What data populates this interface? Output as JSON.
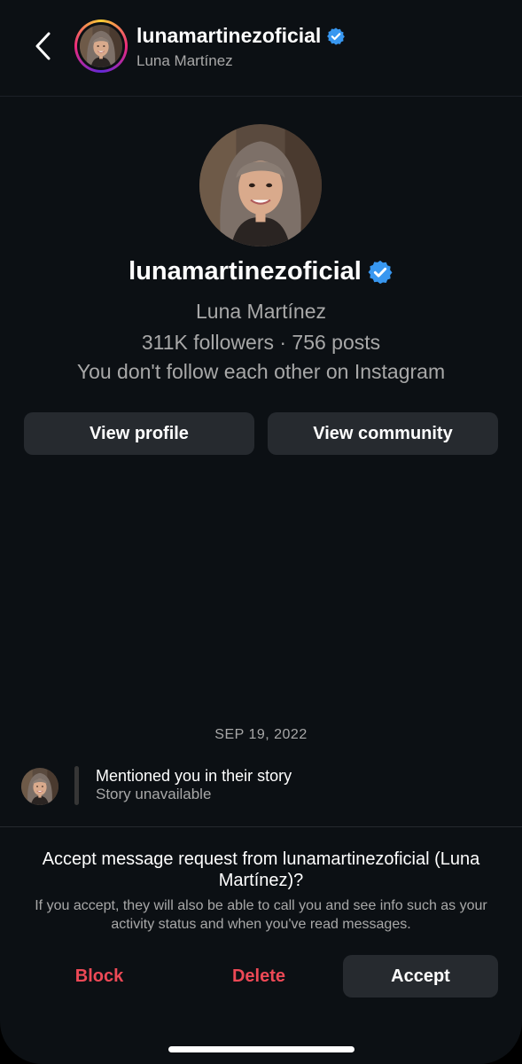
{
  "header": {
    "username": "lunamartinezoficial",
    "display_name": "Luna Martínez",
    "verified_icon": "verified-badge-icon",
    "back_icon": "chevron-left-icon"
  },
  "profile": {
    "username": "lunamartinezoficial",
    "display_name": "Luna Martínez",
    "stats": "311K followers · 756 posts",
    "relationship": "You don't follow each other on Instagram",
    "view_profile_label": "View profile",
    "view_community_label": "View community"
  },
  "thread": {
    "date": "SEP 19, 2022",
    "story_title": "Mentioned you in their story",
    "story_status": "Story unavailable"
  },
  "request": {
    "title": "Accept message request from lunamartinezoficial (Luna Martínez)?",
    "description": "If you accept, they will also be able to call you and see info such as your activity status and when you've read messages.",
    "block_label": "Block",
    "delete_label": "Delete",
    "accept_label": "Accept"
  },
  "colors": {
    "background": "#0c1014",
    "button_bg": "#262a2f",
    "danger": "#ed4956",
    "verified": "#3897f0",
    "muted_text": "#a8a8a8"
  }
}
